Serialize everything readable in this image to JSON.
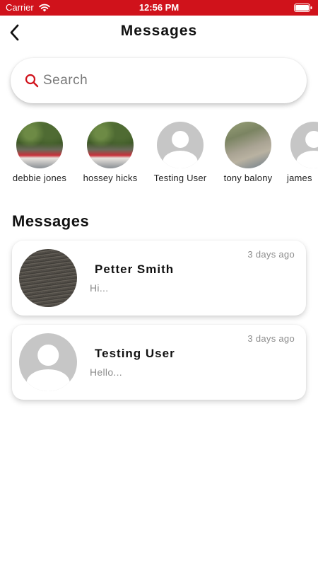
{
  "status_bar": {
    "carrier": "Carrier",
    "time": "12:56 PM",
    "wifi_icon": "wifi-icon",
    "battery_icon": "battery-icon"
  },
  "header": {
    "title": "Messages",
    "back_icon": "chevron-left-icon"
  },
  "search": {
    "placeholder": "Search",
    "value": ""
  },
  "stories": [
    {
      "name": "debbie jones",
      "avatar": "photo-trees"
    },
    {
      "name": "hossey hicks",
      "avatar": "photo-trees"
    },
    {
      "name": "Testing User",
      "avatar": "default-avatar"
    },
    {
      "name": "tony balony",
      "avatar": "photo-utv"
    },
    {
      "name": "james",
      "avatar": "default-avatar"
    }
  ],
  "section_title": "Messages",
  "messages": [
    {
      "name": "Petter Smith",
      "preview": "Hi...",
      "time": "3 days ago",
      "avatar": "photo-metal"
    },
    {
      "name": "Testing User",
      "preview": "Hello...",
      "time": "3 days ago",
      "avatar": "default-avatar"
    }
  ],
  "colors": {
    "accent": "#d0121b",
    "muted_text": "#8d8d8d",
    "placeholder_avatar": "#c6c6c6"
  }
}
